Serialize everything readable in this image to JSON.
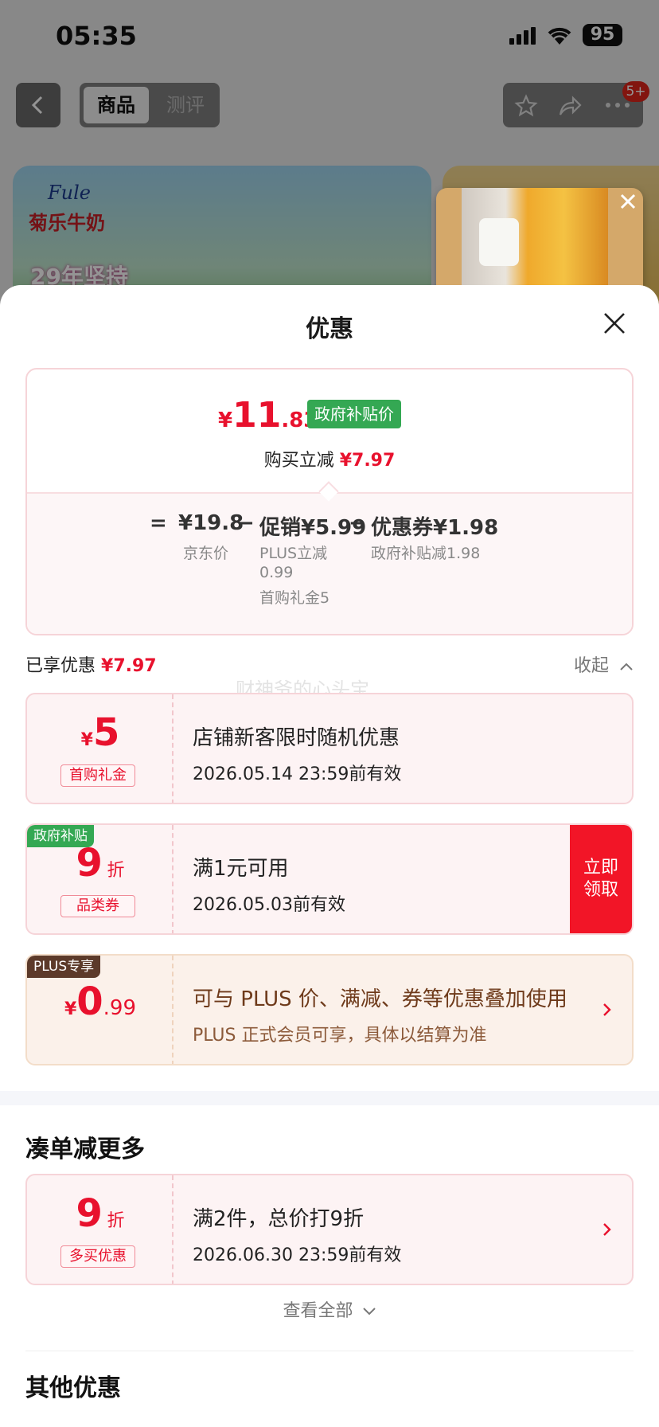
{
  "status_bar": {
    "time": "05:35",
    "battery": "95"
  },
  "header": {
    "tab_active": "商品",
    "tab_inactive": "测评",
    "badge": "5+"
  },
  "banner": {
    "logo": "Fule",
    "brand": "菊乐牛奶",
    "slogan": "29年坚持"
  },
  "sheet": {
    "title": "优惠"
  },
  "price": {
    "currency": "¥",
    "integer": "11",
    "decimal": ".83",
    "tag": "政府补贴价",
    "buy_minus_label": "购买立减",
    "buy_minus_value": "¥7.97",
    "eq": "=",
    "jd_price": "¥19.8",
    "jd_price_label": "京东价",
    "minus1": "−",
    "promo": "促销¥5.99",
    "promo_sub1": "PLUS立减",
    "promo_sub2": "0.99",
    "promo_sub3": "首购礼金5",
    "minus2": "−",
    "coupon": "优惠券¥1.98",
    "coupon_sub": "政府补贴减1.98"
  },
  "enjoyed": {
    "label": "已享优惠",
    "value": "¥7.97",
    "collapse": "收起"
  },
  "watermark": "财神爷的心头宝",
  "coupons": [
    {
      "symbol": "¥",
      "amount": "5",
      "tag": "首购礼金",
      "title": "店铺新客限时随机优惠",
      "subtitle": "2026.05.14 23:59前有效"
    },
    {
      "corner": "政府补贴",
      "amount": "9",
      "unit": "折",
      "tag": "品类券",
      "title": "满1元可用",
      "subtitle": "2026.05.03前有效",
      "button": "立即领取",
      "button_line1": "立即",
      "button_line2": "领取"
    },
    {
      "corner": "PLUS专享",
      "symbol": "¥",
      "amount": "0",
      "decimal": ".99",
      "title": "可与 PLUS 价、满减、券等优惠叠加使用",
      "subtitle": "PLUS 正式会员可享，具体以结算为准"
    }
  ],
  "more_section": {
    "title": "凑单减更多",
    "coupon": {
      "amount": "9",
      "unit": "折",
      "tag": "多买优惠",
      "title": "满2件，总价打9折",
      "subtitle": "2026.06.30 23:59前有效"
    },
    "view_all": "查看全部"
  },
  "other_section": {
    "title": "其他优惠"
  },
  "colors": {
    "accent": "#e8112d",
    "gov_green": "#34a853",
    "plus_brown": "#5c3a2a"
  }
}
